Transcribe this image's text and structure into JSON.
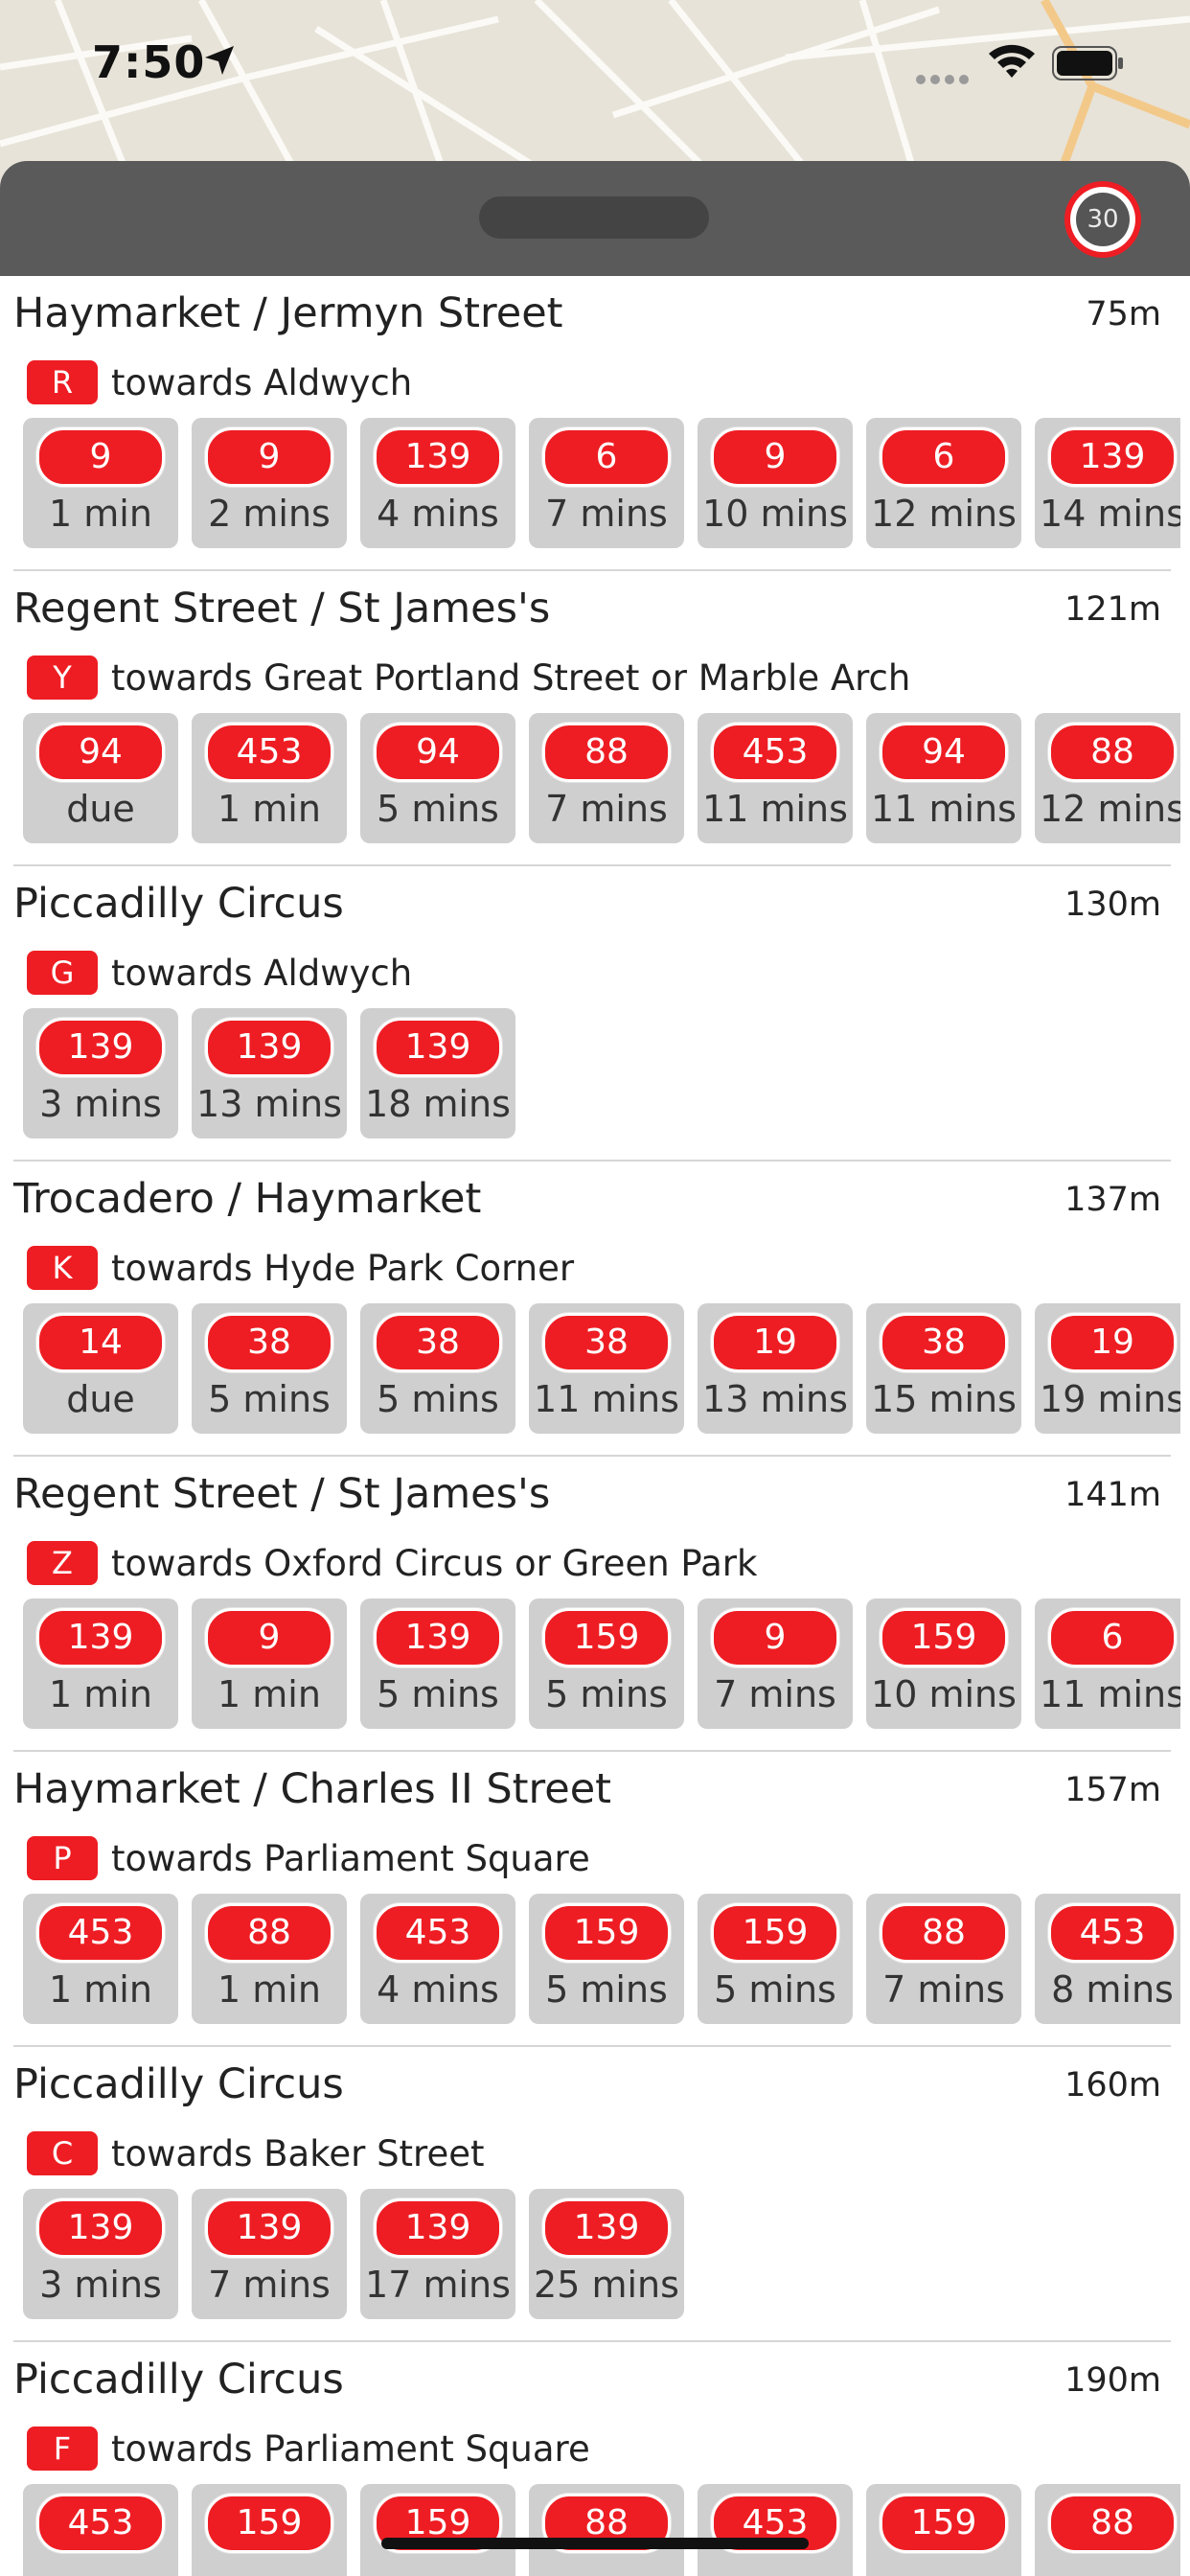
{
  "status_bar": {
    "time": "7:50",
    "location_icon": "location-arrow-icon",
    "wifi_icon": "wifi-icon",
    "battery_icon": "battery-icon"
  },
  "sheet": {
    "refresh_countdown": "30",
    "refresh_icon": "countdown-ring-icon"
  },
  "colors": {
    "accent_red": "#ee1d23",
    "header_gray": "#5a5a5a",
    "tile_gray": "#cfcfcf"
  },
  "stops": [
    {
      "name": "Haymarket / Jermyn Street",
      "distance": "75m",
      "letter": "R",
      "towards": "towards Aldwych",
      "departures": [
        {
          "route": "9",
          "eta": "1 min"
        },
        {
          "route": "9",
          "eta": "2 mins"
        },
        {
          "route": "139",
          "eta": "4 mins"
        },
        {
          "route": "6",
          "eta": "7 mins"
        },
        {
          "route": "9",
          "eta": "10 mins"
        },
        {
          "route": "6",
          "eta": "12 mins"
        },
        {
          "route": "139",
          "eta": "14 mins"
        }
      ]
    },
    {
      "name": "Regent Street / St James's",
      "distance": "121m",
      "letter": "Y",
      "towards": "towards Great Portland Street or Marble Arch",
      "departures": [
        {
          "route": "94",
          "eta": "due"
        },
        {
          "route": "453",
          "eta": "1 min"
        },
        {
          "route": "94",
          "eta": "5 mins"
        },
        {
          "route": "88",
          "eta": "7 mins"
        },
        {
          "route": "453",
          "eta": "11 mins"
        },
        {
          "route": "94",
          "eta": "11 mins"
        },
        {
          "route": "88",
          "eta": "12 mins"
        }
      ]
    },
    {
      "name": "Piccadilly Circus",
      "distance": "130m",
      "letter": "G",
      "towards": "towards Aldwych",
      "departures": [
        {
          "route": "139",
          "eta": "3 mins"
        },
        {
          "route": "139",
          "eta": "13 mins"
        },
        {
          "route": "139",
          "eta": "18 mins"
        }
      ]
    },
    {
      "name": "Trocadero / Haymarket",
      "distance": "137m",
      "letter": "K",
      "towards": "towards Hyde Park Corner",
      "departures": [
        {
          "route": "14",
          "eta": "due"
        },
        {
          "route": "38",
          "eta": "5 mins"
        },
        {
          "route": "38",
          "eta": "5 mins"
        },
        {
          "route": "38",
          "eta": "11 mins"
        },
        {
          "route": "19",
          "eta": "13 mins"
        },
        {
          "route": "38",
          "eta": "15 mins"
        },
        {
          "route": "19",
          "eta": "19 mins"
        }
      ]
    },
    {
      "name": "Regent Street / St James's",
      "distance": "141m",
      "letter": "Z",
      "towards": "towards Oxford Circus or Green Park",
      "departures": [
        {
          "route": "139",
          "eta": "1 min"
        },
        {
          "route": "9",
          "eta": "1 min"
        },
        {
          "route": "139",
          "eta": "5 mins"
        },
        {
          "route": "159",
          "eta": "5 mins"
        },
        {
          "route": "9",
          "eta": "7 mins"
        },
        {
          "route": "159",
          "eta": "10 mins"
        },
        {
          "route": "6",
          "eta": "11 mins"
        }
      ]
    },
    {
      "name": "Haymarket / Charles II Street",
      "distance": "157m",
      "letter": "P",
      "towards": "towards Parliament Square",
      "departures": [
        {
          "route": "453",
          "eta": "1 min"
        },
        {
          "route": "88",
          "eta": "1 min"
        },
        {
          "route": "453",
          "eta": "4 mins"
        },
        {
          "route": "159",
          "eta": "5 mins"
        },
        {
          "route": "159",
          "eta": "5 mins"
        },
        {
          "route": "88",
          "eta": "7 mins"
        },
        {
          "route": "453",
          "eta": "8 mins"
        }
      ]
    },
    {
      "name": "Piccadilly Circus",
      "distance": "160m",
      "letter": "C",
      "towards": "towards Baker Street",
      "departures": [
        {
          "route": "139",
          "eta": "3 mins"
        },
        {
          "route": "139",
          "eta": "7 mins"
        },
        {
          "route": "139",
          "eta": "17 mins"
        },
        {
          "route": "139",
          "eta": "25 mins"
        }
      ]
    },
    {
      "name": "Piccadilly Circus",
      "distance": "190m",
      "letter": "F",
      "towards": "towards Parliament Square",
      "departures": [
        {
          "route": "453",
          "eta": ""
        },
        {
          "route": "159",
          "eta": ""
        },
        {
          "route": "159",
          "eta": ""
        },
        {
          "route": "88",
          "eta": ""
        },
        {
          "route": "453",
          "eta": ""
        },
        {
          "route": "159",
          "eta": ""
        },
        {
          "route": "88",
          "eta": ""
        }
      ]
    }
  ]
}
